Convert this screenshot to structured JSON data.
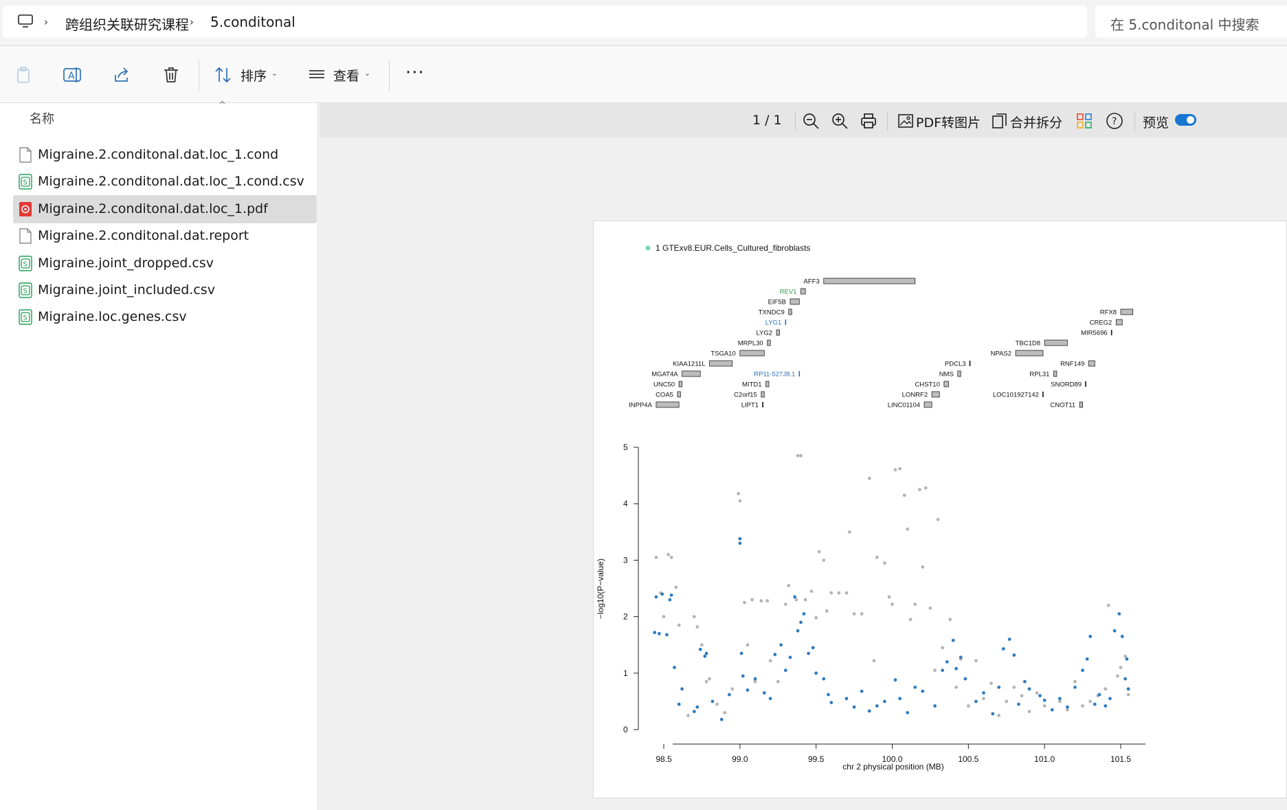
{
  "address": {
    "breadcrumbs": [
      "跨组织关联研究课程",
      "5.conditonal"
    ],
    "search_placeholder": "在 5.conditonal 中搜索"
  },
  "toolbar": {
    "sort_label": "排序",
    "view_label": "查看",
    "more_label": "···"
  },
  "filelist": {
    "column_name": "名称",
    "files": [
      {
        "name": "Migraine.2.conditonal.dat.loc_1.cond",
        "icon": "file-icon"
      },
      {
        "name": "Migraine.2.conditonal.dat.loc_1.cond.csv",
        "icon": "csv-icon"
      },
      {
        "name": "Migraine.2.conditonal.dat.loc_1.pdf",
        "icon": "pdf-icon",
        "selected": true
      },
      {
        "name": "Migraine.2.conditonal.dat.report",
        "icon": "file-icon"
      },
      {
        "name": "Migraine.joint_dropped.csv",
        "icon": "csv-icon"
      },
      {
        "name": "Migraine.joint_included.csv",
        "icon": "csv-icon"
      },
      {
        "name": "Migraine.loc.genes.csv",
        "icon": "csv-icon"
      }
    ]
  },
  "preview": {
    "page_indicator": "1 / 1",
    "pdf_to_image": "PDF转图片",
    "merge_split": "合并拆分",
    "preview_label": "预览"
  },
  "colors": {
    "accent": "#1976d2",
    "point_blue": "#2f7bbd",
    "point_grey": "#b4b4b4",
    "legend_teal": "#7fd2c4",
    "gene_bar": "#bdbdbd",
    "gene_green": "#2e9a4a",
    "gene_blue": "#2f6fb5"
  },
  "chart_data": {
    "type": "scatter",
    "legend": "1 GTExv8.EUR.Cells_Cultured_fibroblasts",
    "xlabel": "chr 2 physical position (MB)",
    "ylabel": "−log10(P−value)",
    "xlim": [
      98.4,
      101.6
    ],
    "ylim": [
      0,
      5
    ],
    "xticks": [
      "98.5",
      "99.0",
      "99.5",
      "100.0",
      "100.5",
      "101.0",
      "101.5"
    ],
    "yticks": [
      "0",
      "1",
      "2",
      "3",
      "4",
      "5"
    ],
    "genes": [
      {
        "name": "AFF3",
        "start": 99.55,
        "end": 100.15,
        "row": 0
      },
      {
        "name": "REV1",
        "start": 99.4,
        "end": 99.43,
        "row": 1,
        "color": "green"
      },
      {
        "name": "EIF5B",
        "start": 99.33,
        "end": 99.39,
        "row": 2
      },
      {
        "name": "TXNDC9",
        "start": 99.32,
        "end": 99.34,
        "row": 3
      },
      {
        "name": "RFX8",
        "start": 101.5,
        "end": 101.58,
        "row": 3
      },
      {
        "name": "LYG1",
        "start": 99.3,
        "end": 99.31,
        "row": 4,
        "color": "blue"
      },
      {
        "name": "CREG2",
        "start": 101.47,
        "end": 101.51,
        "row": 4
      },
      {
        "name": "LYG2",
        "start": 99.24,
        "end": 99.26,
        "row": 5
      },
      {
        "name": "MIR5696",
        "start": 101.44,
        "end": 101.45,
        "row": 5
      },
      {
        "name": "MRPL30",
        "start": 99.18,
        "end": 99.2,
        "row": 6
      },
      {
        "name": "TBC1D8",
        "start": 101.0,
        "end": 101.15,
        "row": 6
      },
      {
        "name": "TSGA10",
        "start": 99.0,
        "end": 99.16,
        "row": 7
      },
      {
        "name": "NPAS2",
        "start": 100.81,
        "end": 100.99,
        "row": 7
      },
      {
        "name": "KIAA1211L",
        "start": 98.8,
        "end": 98.95,
        "row": 8
      },
      {
        "name": "PDCL3",
        "start": 100.51,
        "end": 100.52,
        "row": 8
      },
      {
        "name": "RNF149",
        "start": 101.29,
        "end": 101.33,
        "row": 8
      },
      {
        "name": "MGAT4A",
        "start": 98.62,
        "end": 98.74,
        "row": 9
      },
      {
        "name": "RP11-527J8.1",
        "start": 99.39,
        "end": 99.4,
        "row": 9,
        "color": "blue"
      },
      {
        "name": "NMS",
        "start": 100.43,
        "end": 100.45,
        "row": 9
      },
      {
        "name": "RPL31",
        "start": 101.06,
        "end": 101.08,
        "row": 9
      },
      {
        "name": "UNC50",
        "start": 98.6,
        "end": 98.62,
        "row": 10
      },
      {
        "name": "MITD1",
        "start": 99.17,
        "end": 99.19,
        "row": 10
      },
      {
        "name": "CHST10",
        "start": 100.34,
        "end": 100.37,
        "row": 10
      },
      {
        "name": "SNORD89",
        "start": 101.27,
        "end": 101.28,
        "row": 10
      },
      {
        "name": "COA5",
        "start": 98.59,
        "end": 98.61,
        "row": 11
      },
      {
        "name": "C2orf15",
        "start": 99.14,
        "end": 99.16,
        "row": 11
      },
      {
        "name": "LONRF2",
        "start": 100.26,
        "end": 100.31,
        "row": 11
      },
      {
        "name": "LOC101927142",
        "start": 100.99,
        "end": 101.0,
        "row": 11
      },
      {
        "name": "INPP4A",
        "start": 98.45,
        "end": 98.6,
        "row": 12
      },
      {
        "name": "LIPT1",
        "start": 99.15,
        "end": 99.16,
        "row": 12
      },
      {
        "name": "LINC01104",
        "start": 100.21,
        "end": 100.26,
        "row": 12
      },
      {
        "name": "CNOT11",
        "start": 101.23,
        "end": 101.25,
        "row": 12
      }
    ],
    "series": [
      {
        "name": "1 GTExv8.EUR.Cells_Cultured_fibroblasts",
        "color": "blue",
        "points": [
          [
            98.44,
            1.72
          ],
          [
            98.45,
            2.35
          ],
          [
            98.47,
            1.7
          ],
          [
            98.49,
            2.4
          ],
          [
            98.52,
            1.68
          ],
          [
            98.54,
            2.3
          ],
          [
            98.55,
            2.38
          ],
          [
            98.57,
            1.1
          ],
          [
            98.6,
            0.45
          ],
          [
            98.62,
            0.72
          ],
          [
            98.7,
            0.32
          ],
          [
            98.72,
            0.4
          ],
          [
            98.74,
            1.42
          ],
          [
            98.77,
            1.3
          ],
          [
            98.78,
            1.35
          ],
          [
            98.82,
            0.5
          ],
          [
            98.88,
            0.18
          ],
          [
            98.93,
            0.62
          ],
          [
            99.0,
            3.38
          ],
          [
            99.0,
            3.3
          ],
          [
            99.01,
            1.35
          ],
          [
            99.02,
            0.95
          ],
          [
            99.05,
            0.7
          ],
          [
            99.1,
            0.9
          ],
          [
            99.16,
            0.65
          ],
          [
            99.2,
            0.55
          ],
          [
            99.23,
            1.33
          ],
          [
            99.27,
            1.5
          ],
          [
            99.3,
            1.05
          ],
          [
            99.33,
            1.28
          ],
          [
            99.36,
            2.35
          ],
          [
            99.38,
            1.75
          ],
          [
            99.4,
            1.9
          ],
          [
            99.42,
            2.05
          ],
          [
            99.45,
            1.35
          ],
          [
            99.48,
            1.45
          ],
          [
            99.5,
            1.0
          ],
          [
            99.55,
            0.9
          ],
          [
            99.58,
            0.62
          ],
          [
            99.6,
            0.48
          ],
          [
            99.7,
            0.55
          ],
          [
            99.75,
            0.4
          ],
          [
            99.8,
            0.68
          ],
          [
            99.85,
            0.33
          ],
          [
            99.9,
            0.42
          ],
          [
            99.95,
            0.5
          ],
          [
            100.02,
            0.88
          ],
          [
            100.05,
            0.55
          ],
          [
            100.1,
            0.3
          ],
          [
            100.15,
            0.75
          ],
          [
            100.2,
            0.68
          ],
          [
            100.28,
            0.42
          ],
          [
            100.33,
            1.05
          ],
          [
            100.36,
            1.2
          ],
          [
            100.4,
            1.58
          ],
          [
            100.42,
            1.08
          ],
          [
            100.45,
            1.28
          ],
          [
            100.48,
            0.9
          ],
          [
            100.55,
            0.5
          ],
          [
            100.6,
            0.65
          ],
          [
            100.66,
            0.28
          ],
          [
            100.7,
            0.75
          ],
          [
            100.73,
            1.43
          ],
          [
            100.77,
            1.6
          ],
          [
            100.8,
            1.32
          ],
          [
            100.83,
            0.45
          ],
          [
            100.87,
            0.85
          ],
          [
            100.9,
            0.72
          ],
          [
            100.97,
            0.6
          ],
          [
            101.0,
            0.52
          ],
          [
            101.05,
            0.35
          ],
          [
            101.1,
            0.55
          ],
          [
            101.15,
            0.4
          ],
          [
            101.2,
            0.75
          ],
          [
            101.25,
            1.05
          ],
          [
            101.28,
            1.25
          ],
          [
            101.3,
            1.65
          ],
          [
            101.33,
            0.45
          ],
          [
            101.36,
            0.62
          ],
          [
            101.4,
            0.42
          ],
          [
            101.43,
            0.55
          ],
          [
            101.46,
            1.75
          ],
          [
            101.49,
            2.05
          ],
          [
            101.51,
            1.65
          ],
          [
            101.53,
            0.9
          ],
          [
            101.54,
            1.25
          ],
          [
            101.55,
            0.72
          ]
        ]
      },
      {
        "name": "",
        "color": "grey",
        "points": [
          [
            98.45,
            3.05
          ],
          [
            98.48,
            2.42
          ],
          [
            98.5,
            2.0
          ],
          [
            98.53,
            3.1
          ],
          [
            98.55,
            3.05
          ],
          [
            98.58,
            2.52
          ],
          [
            98.6,
            1.85
          ],
          [
            98.66,
            0.25
          ],
          [
            98.7,
            2.0
          ],
          [
            98.72,
            1.82
          ],
          [
            98.75,
            1.5
          ],
          [
            98.78,
            0.85
          ],
          [
            98.8,
            0.9
          ],
          [
            98.85,
            0.45
          ],
          [
            98.9,
            0.3
          ],
          [
            98.95,
            0.72
          ],
          [
            98.99,
            4.18
          ],
          [
            99.0,
            4.05
          ],
          [
            99.03,
            2.25
          ],
          [
            99.05,
            1.5
          ],
          [
            99.08,
            2.3
          ],
          [
            99.1,
            0.85
          ],
          [
            99.14,
            2.28
          ],
          [
            99.18,
            2.28
          ],
          [
            99.2,
            1.22
          ],
          [
            99.25,
            0.85
          ],
          [
            99.3,
            2.22
          ],
          [
            99.32,
            2.55
          ],
          [
            99.37,
            2.3
          ],
          [
            99.38,
            4.85
          ],
          [
            99.4,
            4.85
          ],
          [
            99.43,
            2.3
          ],
          [
            99.47,
            2.45
          ],
          [
            99.5,
            1.98
          ],
          [
            99.52,
            3.15
          ],
          [
            99.55,
            3.0
          ],
          [
            99.57,
            2.1
          ],
          [
            99.6,
            2.42
          ],
          [
            99.65,
            2.42
          ],
          [
            99.7,
            2.42
          ],
          [
            99.72,
            3.5
          ],
          [
            99.75,
            2.05
          ],
          [
            99.8,
            2.05
          ],
          [
            99.85,
            4.45
          ],
          [
            99.88,
            1.22
          ],
          [
            99.9,
            3.05
          ],
          [
            99.95,
            2.95
          ],
          [
            99.98,
            2.35
          ],
          [
            100.0,
            2.22
          ],
          [
            100.02,
            4.6
          ],
          [
            100.05,
            4.62
          ],
          [
            100.08,
            4.15
          ],
          [
            100.1,
            3.55
          ],
          [
            100.12,
            1.95
          ],
          [
            100.15,
            2.22
          ],
          [
            100.18,
            4.25
          ],
          [
            100.2,
            2.88
          ],
          [
            100.22,
            4.28
          ],
          [
            100.25,
            2.15
          ],
          [
            100.28,
            1.05
          ],
          [
            100.3,
            3.72
          ],
          [
            100.33,
            1.45
          ],
          [
            100.38,
            1.95
          ],
          [
            100.42,
            0.75
          ],
          [
            100.45,
            1.25
          ],
          [
            100.5,
            0.42
          ],
          [
            100.55,
            1.22
          ],
          [
            100.6,
            0.55
          ],
          [
            100.65,
            0.82
          ],
          [
            100.7,
            0.25
          ],
          [
            100.75,
            0.5
          ],
          [
            100.8,
            0.75
          ],
          [
            100.85,
            0.6
          ],
          [
            100.9,
            0.32
          ],
          [
            100.95,
            0.65
          ],
          [
            101.0,
            0.42
          ],
          [
            101.1,
            0.5
          ],
          [
            101.15,
            0.35
          ],
          [
            101.2,
            0.85
          ],
          [
            101.25,
            0.42
          ],
          [
            101.3,
            0.5
          ],
          [
            101.35,
            0.6
          ],
          [
            101.4,
            0.72
          ],
          [
            101.42,
            2.2
          ],
          [
            101.48,
            0.95
          ],
          [
            101.5,
            1.1
          ],
          [
            101.53,
            1.3
          ],
          [
            101.55,
            0.62
          ]
        ]
      }
    ]
  }
}
